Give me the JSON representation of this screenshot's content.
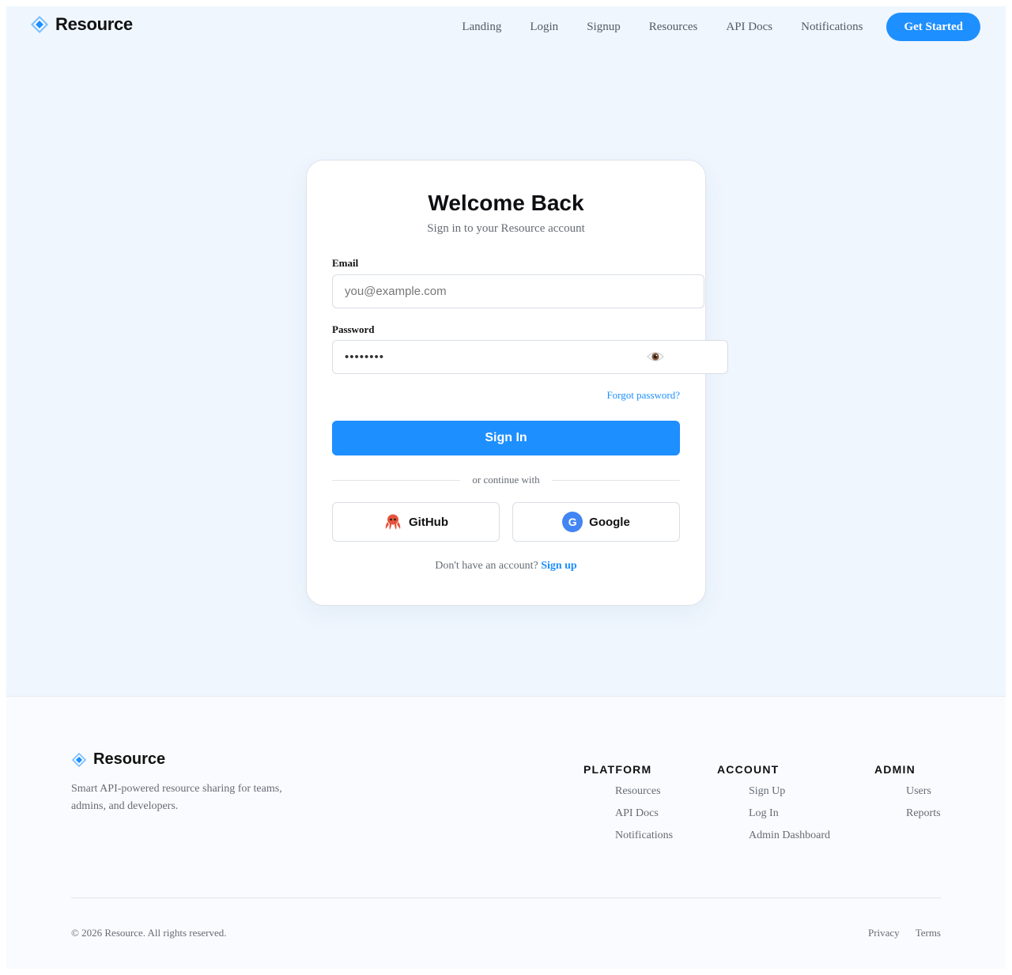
{
  "brand": {
    "name": "Resource",
    "icon": "diamond-icon",
    "accent_color": "#1e8fff"
  },
  "nav": {
    "links": [
      "Landing",
      "Login",
      "Signup",
      "Resources",
      "API Docs",
      "Notifications"
    ],
    "cta": "Get Started"
  },
  "login": {
    "title": "Welcome Back",
    "subtitle": "Sign in to your Resource account",
    "email_label": "Email",
    "email_placeholder": "you@example.com",
    "email_value": "",
    "password_label": "Password",
    "password_value": "••••••••",
    "toggle_icon": "eye-icon",
    "forgot": "Forgot password?",
    "submit": "Sign In",
    "divider": "or continue with",
    "github": {
      "label": "GitHub",
      "icon": "octopus-icon"
    },
    "google": {
      "label": "Google",
      "icon": "google-g-icon",
      "glyph": "G"
    },
    "no_account": "Don't have an account?",
    "signup_link": "Sign up"
  },
  "footer": {
    "brand_name": "Resource",
    "tagline": "Smart API-powered resource sharing for teams, admins, and developers.",
    "columns": [
      {
        "heading": "PLATFORM",
        "items": [
          "Resources",
          "API Docs",
          "Notifications"
        ]
      },
      {
        "heading": "ACCOUNT",
        "items": [
          "Sign Up",
          "Log In",
          "Admin Dashboard"
        ]
      },
      {
        "heading": "ADMIN",
        "items": [
          "Users",
          "Reports"
        ]
      }
    ],
    "copyright": "© 2026 Resource. All rights reserved.",
    "legal": [
      "Privacy",
      "Terms"
    ]
  }
}
